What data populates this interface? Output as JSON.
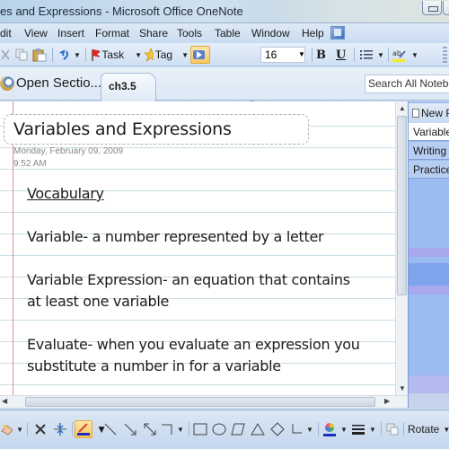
{
  "window": {
    "title": "es and Expressions - Microsoft Office OneNote"
  },
  "menu": {
    "items": [
      {
        "label": "dit",
        "name": "menu-edit"
      },
      {
        "label": "View",
        "name": "menu-view"
      },
      {
        "label": "Insert",
        "name": "menu-insert"
      },
      {
        "label": "Format",
        "name": "menu-format"
      },
      {
        "label": "Share",
        "name": "menu-share"
      },
      {
        "label": "Tools",
        "name": "menu-tools"
      },
      {
        "label": "Table",
        "name": "menu-table"
      },
      {
        "label": "Window",
        "name": "menu-window"
      },
      {
        "label": "Help",
        "name": "menu-help"
      }
    ]
  },
  "toolbar": {
    "task_label": "Task",
    "tag_label": "Tag",
    "font_size": "16",
    "bold_label": "B",
    "underline_label": "U"
  },
  "tabs": {
    "open_sections_label": "Open Sectio...",
    "active_section": "ch3.5",
    "search_placeholder": "Search All Notebooks"
  },
  "page": {
    "title": "Variables and Expressions",
    "date": "Monday, February 09, 2009",
    "time": "9:52 AM",
    "notes": [
      "Vocabulary",
      "Variable- a number represented  by a letter",
      "Variable Expression-  an equation  that contains",
      "at least one variable",
      "Evaluate-  when you evaluate  an expression  you",
      "substitute a number  in for  a variable"
    ]
  },
  "page_tabs": {
    "new_page_label": "New Page",
    "items": [
      {
        "label": "Variables and Expressions",
        "selected": true
      },
      {
        "label": "Writing",
        "selected": false
      },
      {
        "label": "Practice",
        "selected": false
      }
    ]
  },
  "drawing_toolbar": {
    "rotate_label": "Rotate"
  },
  "colors": {
    "margin_line": "#e28b8b",
    "rule_line": "#c8dde4",
    "page_tabs_bg": "#9bbcf0",
    "active_tool": "#f9c760"
  }
}
